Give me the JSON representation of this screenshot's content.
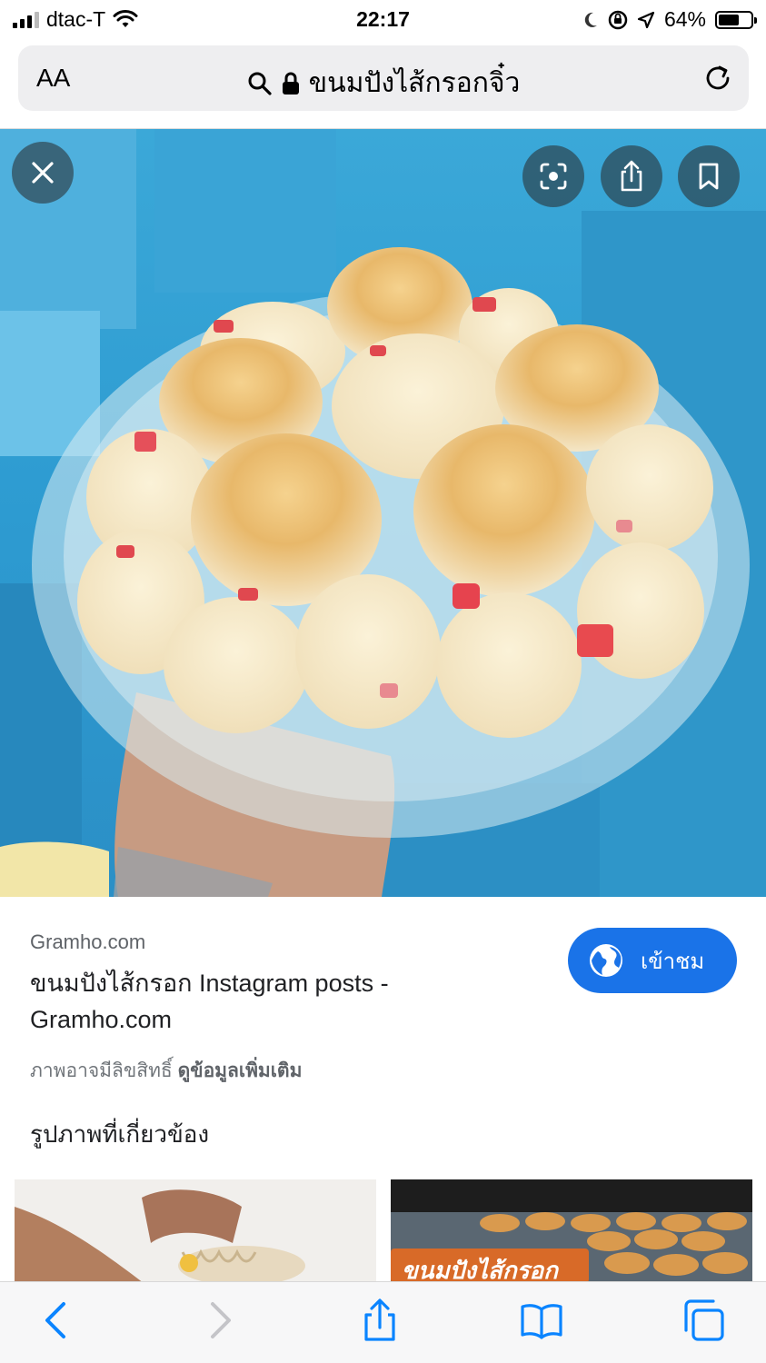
{
  "status_bar": {
    "carrier": "dtac-T",
    "time": "22:17",
    "battery_percent": "64%",
    "battery_level": 0.64,
    "icons": [
      "signal-icon",
      "wifi-icon",
      "moon-icon",
      "orientation-lock-icon",
      "location-icon",
      "battery-icon"
    ]
  },
  "url_bar": {
    "text_size_label": "AA",
    "search_text": "ขนมปังไส้กรอกจิ๋ว",
    "icons": [
      "search-icon",
      "lock-icon",
      "reload-icon"
    ]
  },
  "viewer": {
    "icons": [
      "close-icon",
      "lens-icon",
      "share-icon",
      "bookmark-icon"
    ]
  },
  "result": {
    "source": "Gramho.com",
    "title": "ขนมปังไส้กรอก Instagram posts - Gramho.com",
    "visit_label": "เข้าชม",
    "copyright_text": "ภาพอาจมีลิขสิทธิ์",
    "more_info_label": "ดูข้อมูลเพิ่มเติม",
    "related_heading": "รูปภาพที่เกี่ยวข้อง",
    "thumb_2_caption": "ขนมปังไส้กรอก"
  },
  "toolbar": {
    "icons": [
      "back-icon",
      "forward-icon",
      "share-icon",
      "bookmarks-icon",
      "tabs-icon"
    ]
  },
  "colors": {
    "accent": "#1a73e8",
    "ios_blue": "#0a84ff",
    "url_bar_bg": "#eeeef0"
  }
}
